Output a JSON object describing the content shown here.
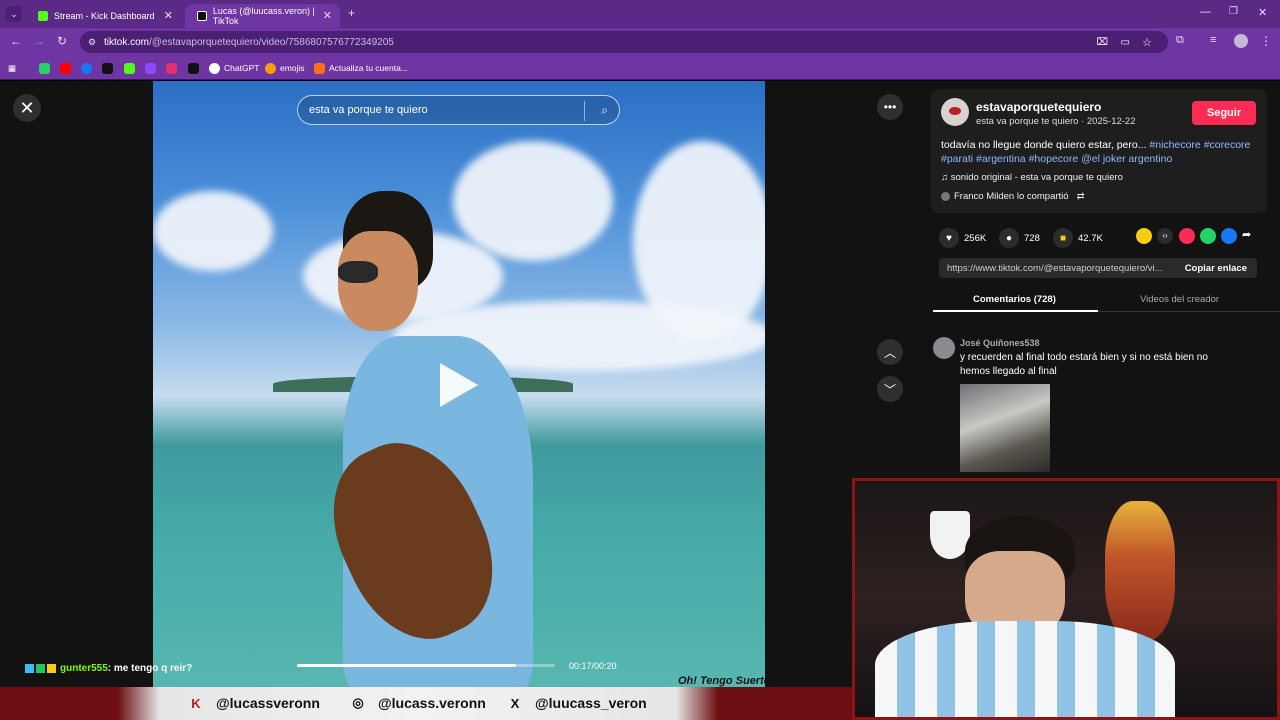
{
  "browser": {
    "tabs": [
      {
        "label": "Stream - Kick Dashboard",
        "color": "#53fc18"
      },
      {
        "label": "Lucas (@luucass.veron) | TikTok",
        "color": "#000000"
      }
    ],
    "url_domain": "tiktok.com",
    "url_path": "/@estavaporquetequiero/video/7586807576772349205",
    "bookmarks": [
      {
        "label": "",
        "color": "#25d366"
      },
      {
        "label": "",
        "color": "#ff0000"
      },
      {
        "label": "",
        "color": "#1877f2"
      },
      {
        "label": "",
        "color": "#111111"
      },
      {
        "label": "",
        "color": "#53fc18"
      },
      {
        "label": "",
        "color": "#9146ff"
      },
      {
        "label": "",
        "color": "#e1306c"
      },
      {
        "label": "",
        "color": "#111111"
      },
      {
        "label": "ChatGPT",
        "color": "#ffffff"
      },
      {
        "label": "emojis",
        "color": "#f59e0b"
      },
      {
        "label": "Actualiza tu cuenta...",
        "color": "#f97316"
      }
    ]
  },
  "video": {
    "search_placeholder": "esta va porque te quiero",
    "time": "00:17/00:20",
    "progress": 0.85,
    "watermark": "Oh! Tengo Suerte"
  },
  "post": {
    "username": "estavaporquetequiero",
    "subline": "esta va porque te quiero · 2025-12-22",
    "follow_label": "Seguir",
    "desc_text": "todavía no llegue donde quiero estar, pero... ",
    "desc_tags": "#nichecore #corecore #parati #argentina #hopecore @el joker argentino",
    "sound": "♫  sonido original - esta va porque te quiero",
    "shared": "Franco Milden lo compartió",
    "likes": "256K",
    "comments": "728",
    "saves": "42.7K",
    "link": "https://www.tiktok.com/@estavaporquetequiero/vi...",
    "copy_label": "Copiar enlace"
  },
  "tabs_panel": {
    "comments_tab": "Comentarios (728)",
    "creator_tab": "Videos del creador"
  },
  "comment": {
    "author": "José Quiñones538",
    "text": "y recuerden al final todo estará bien y si no está bien no hemos llegado al final"
  },
  "overlay": {
    "chat_user": "gunter555",
    "chat_msg": ": me tengo q reir?",
    "socials": [
      {
        "icon": "K",
        "label": "@lucassveronn"
      },
      {
        "icon": "◎",
        "label": "@lucass.veronn"
      },
      {
        "icon": "X",
        "label": "@luucass_veron"
      }
    ]
  }
}
